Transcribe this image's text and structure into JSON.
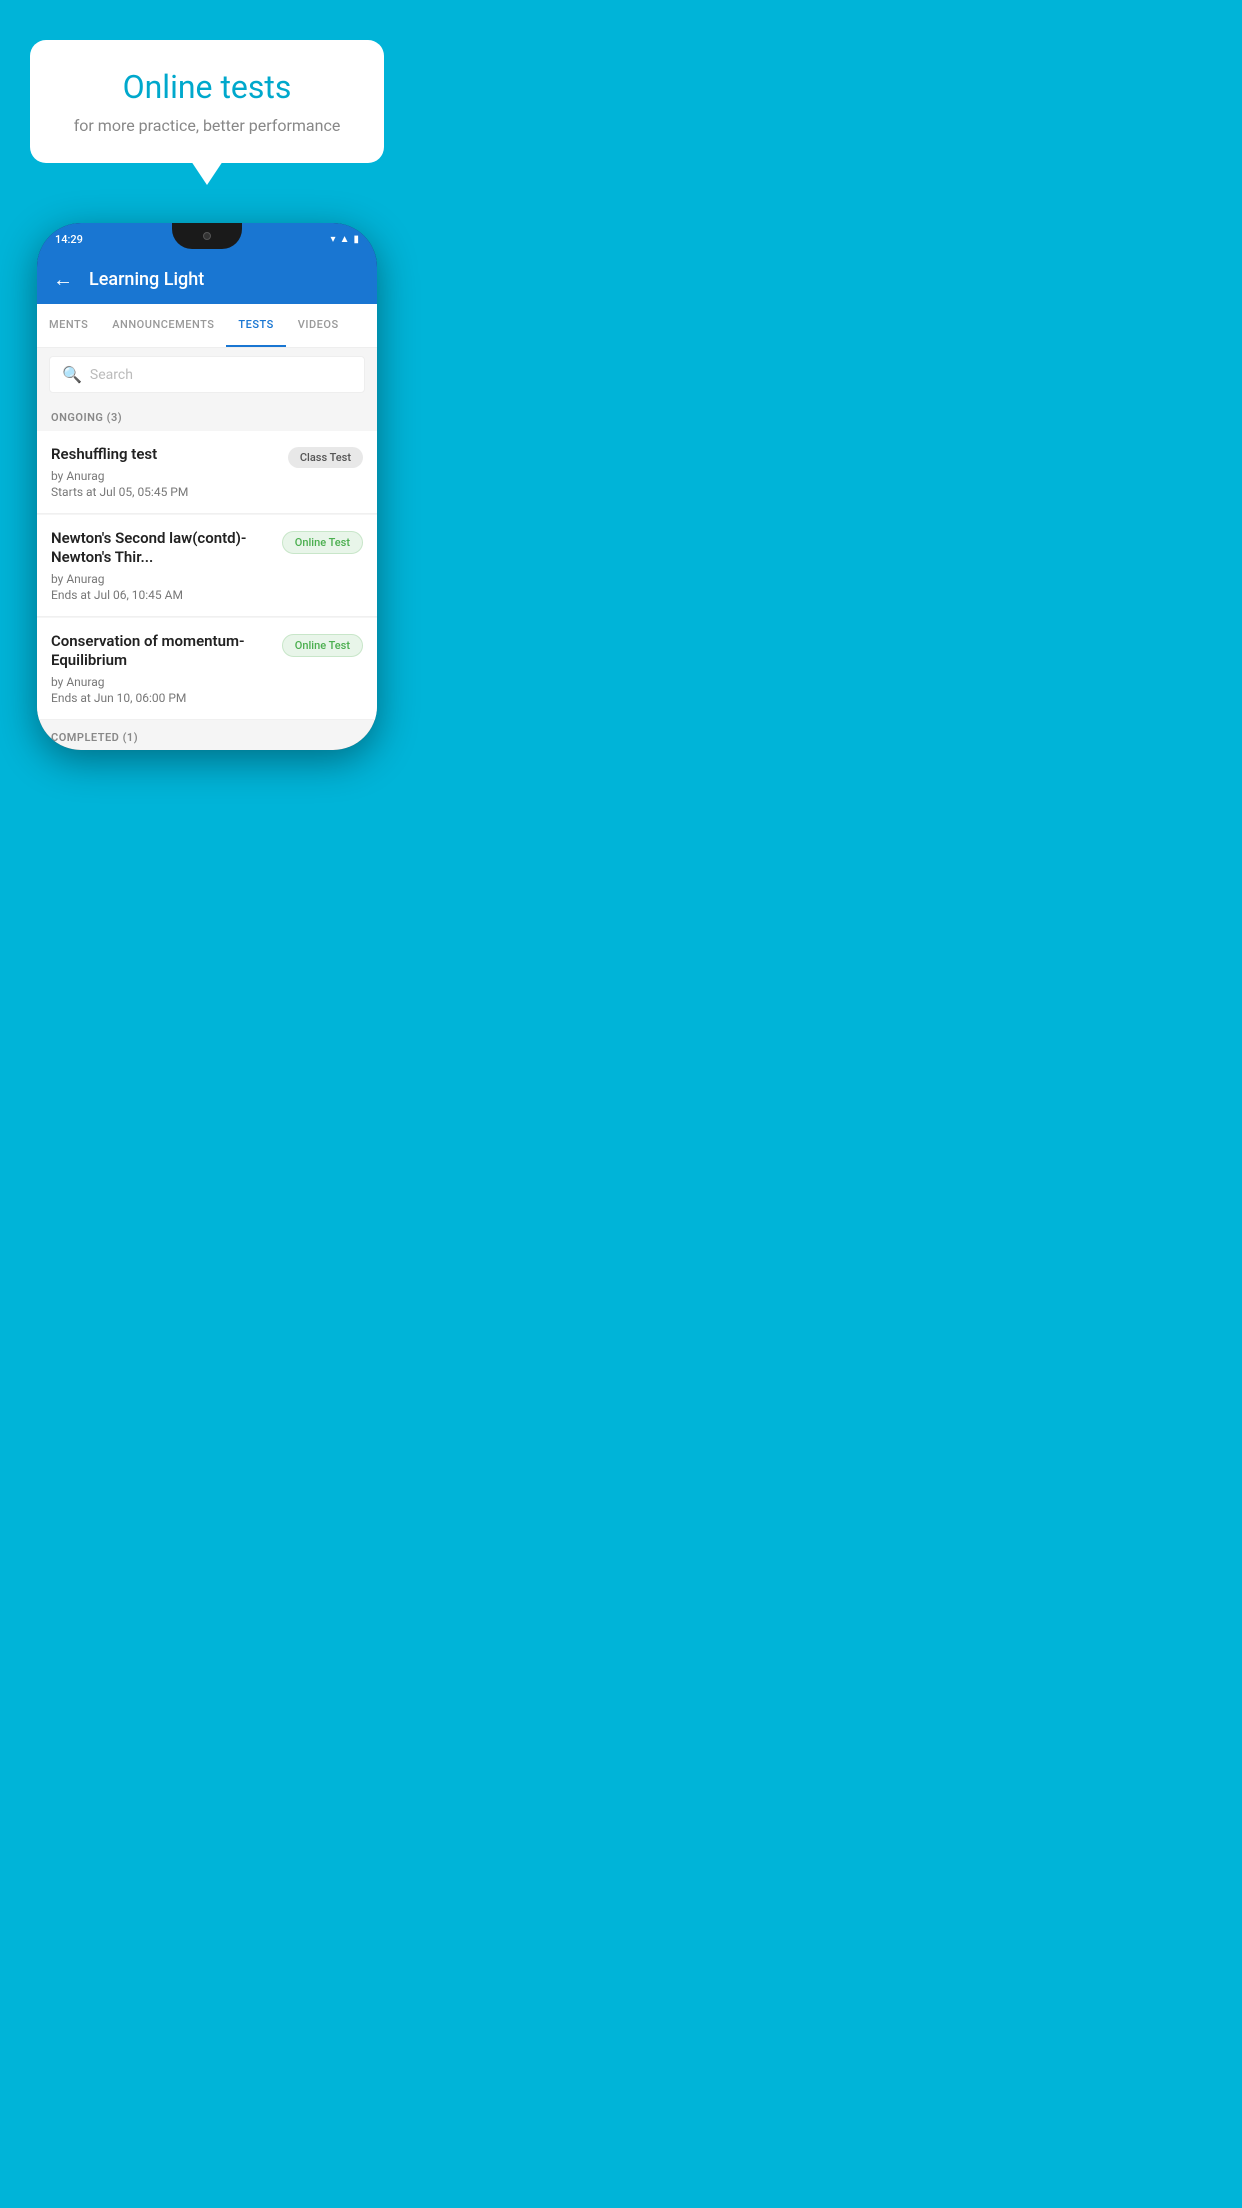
{
  "background_color": "#00B4D8",
  "speech_bubble": {
    "title": "Online tests",
    "subtitle": "for more practice, better performance"
  },
  "phone": {
    "status_bar": {
      "time": "14:29",
      "icons": [
        "wifi",
        "signal",
        "battery"
      ]
    },
    "header": {
      "title": "Learning Light",
      "back_label": "←"
    },
    "tabs": [
      {
        "label": "MENTS",
        "active": false
      },
      {
        "label": "ANNOUNCEMENTS",
        "active": false
      },
      {
        "label": "TESTS",
        "active": true
      },
      {
        "label": "VIDEOS",
        "active": false
      }
    ],
    "search": {
      "placeholder": "Search"
    },
    "sections": [
      {
        "header": "ONGOING (3)",
        "tests": [
          {
            "name": "Reshuffling test",
            "author": "by Anurag",
            "time_label": "Starts at",
            "time": "Jul 05, 05:45 PM",
            "badge": "Class Test",
            "badge_type": "class"
          },
          {
            "name": "Newton's Second law(contd)-Newton's Thir...",
            "author": "by Anurag",
            "time_label": "Ends at",
            "time": "Jul 06, 10:45 AM",
            "badge": "Online Test",
            "badge_type": "online"
          },
          {
            "name": "Conservation of momentum-Equilibrium",
            "author": "by Anurag",
            "time_label": "Ends at",
            "time": "Jun 10, 06:00 PM",
            "badge": "Online Test",
            "badge_type": "online"
          }
        ]
      }
    ],
    "completed_header": "COMPLETED (1)"
  }
}
